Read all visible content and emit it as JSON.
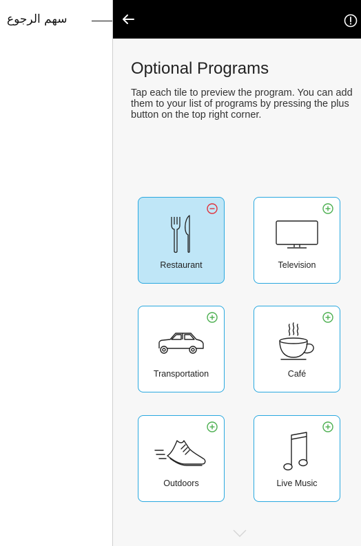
{
  "annotation": {
    "label": "سهم الرجوع"
  },
  "header": {
    "back_icon": "arrow-left-icon",
    "info_icon": "alert-circle-icon"
  },
  "page": {
    "title": "Optional Programs",
    "description": "Tap each tile to preview the program. You can add them to your list of programs by pressing the plus button on the top right corner."
  },
  "tiles": [
    {
      "label": "Restaurant",
      "icon": "fork-knife-icon",
      "state": "added",
      "badge_icon": "minus-circle-icon",
      "badge_color": "#e0333c"
    },
    {
      "label": "Television",
      "icon": "television-icon",
      "state": "available",
      "badge_icon": "plus-circle-icon",
      "badge_color": "#4caf50"
    },
    {
      "label": "Transportation",
      "icon": "car-icon",
      "state": "available",
      "badge_icon": "plus-circle-icon",
      "badge_color": "#4caf50"
    },
    {
      "label": "Café",
      "icon": "coffee-cup-icon",
      "state": "available",
      "badge_icon": "plus-circle-icon",
      "badge_color": "#4caf50"
    },
    {
      "label": "Outdoors",
      "icon": "running-shoe-icon",
      "state": "available",
      "badge_icon": "plus-circle-icon",
      "badge_color": "#4caf50"
    },
    {
      "label": "Live Music",
      "icon": "music-note-icon",
      "state": "available",
      "badge_icon": "plus-circle-icon",
      "badge_color": "#4caf50"
    }
  ],
  "footer": {
    "scroll_icon": "chevron-down-icon"
  },
  "colors": {
    "accent": "#29a8df",
    "selected_tile": "#bfe6f7",
    "topbar": "#000000"
  }
}
